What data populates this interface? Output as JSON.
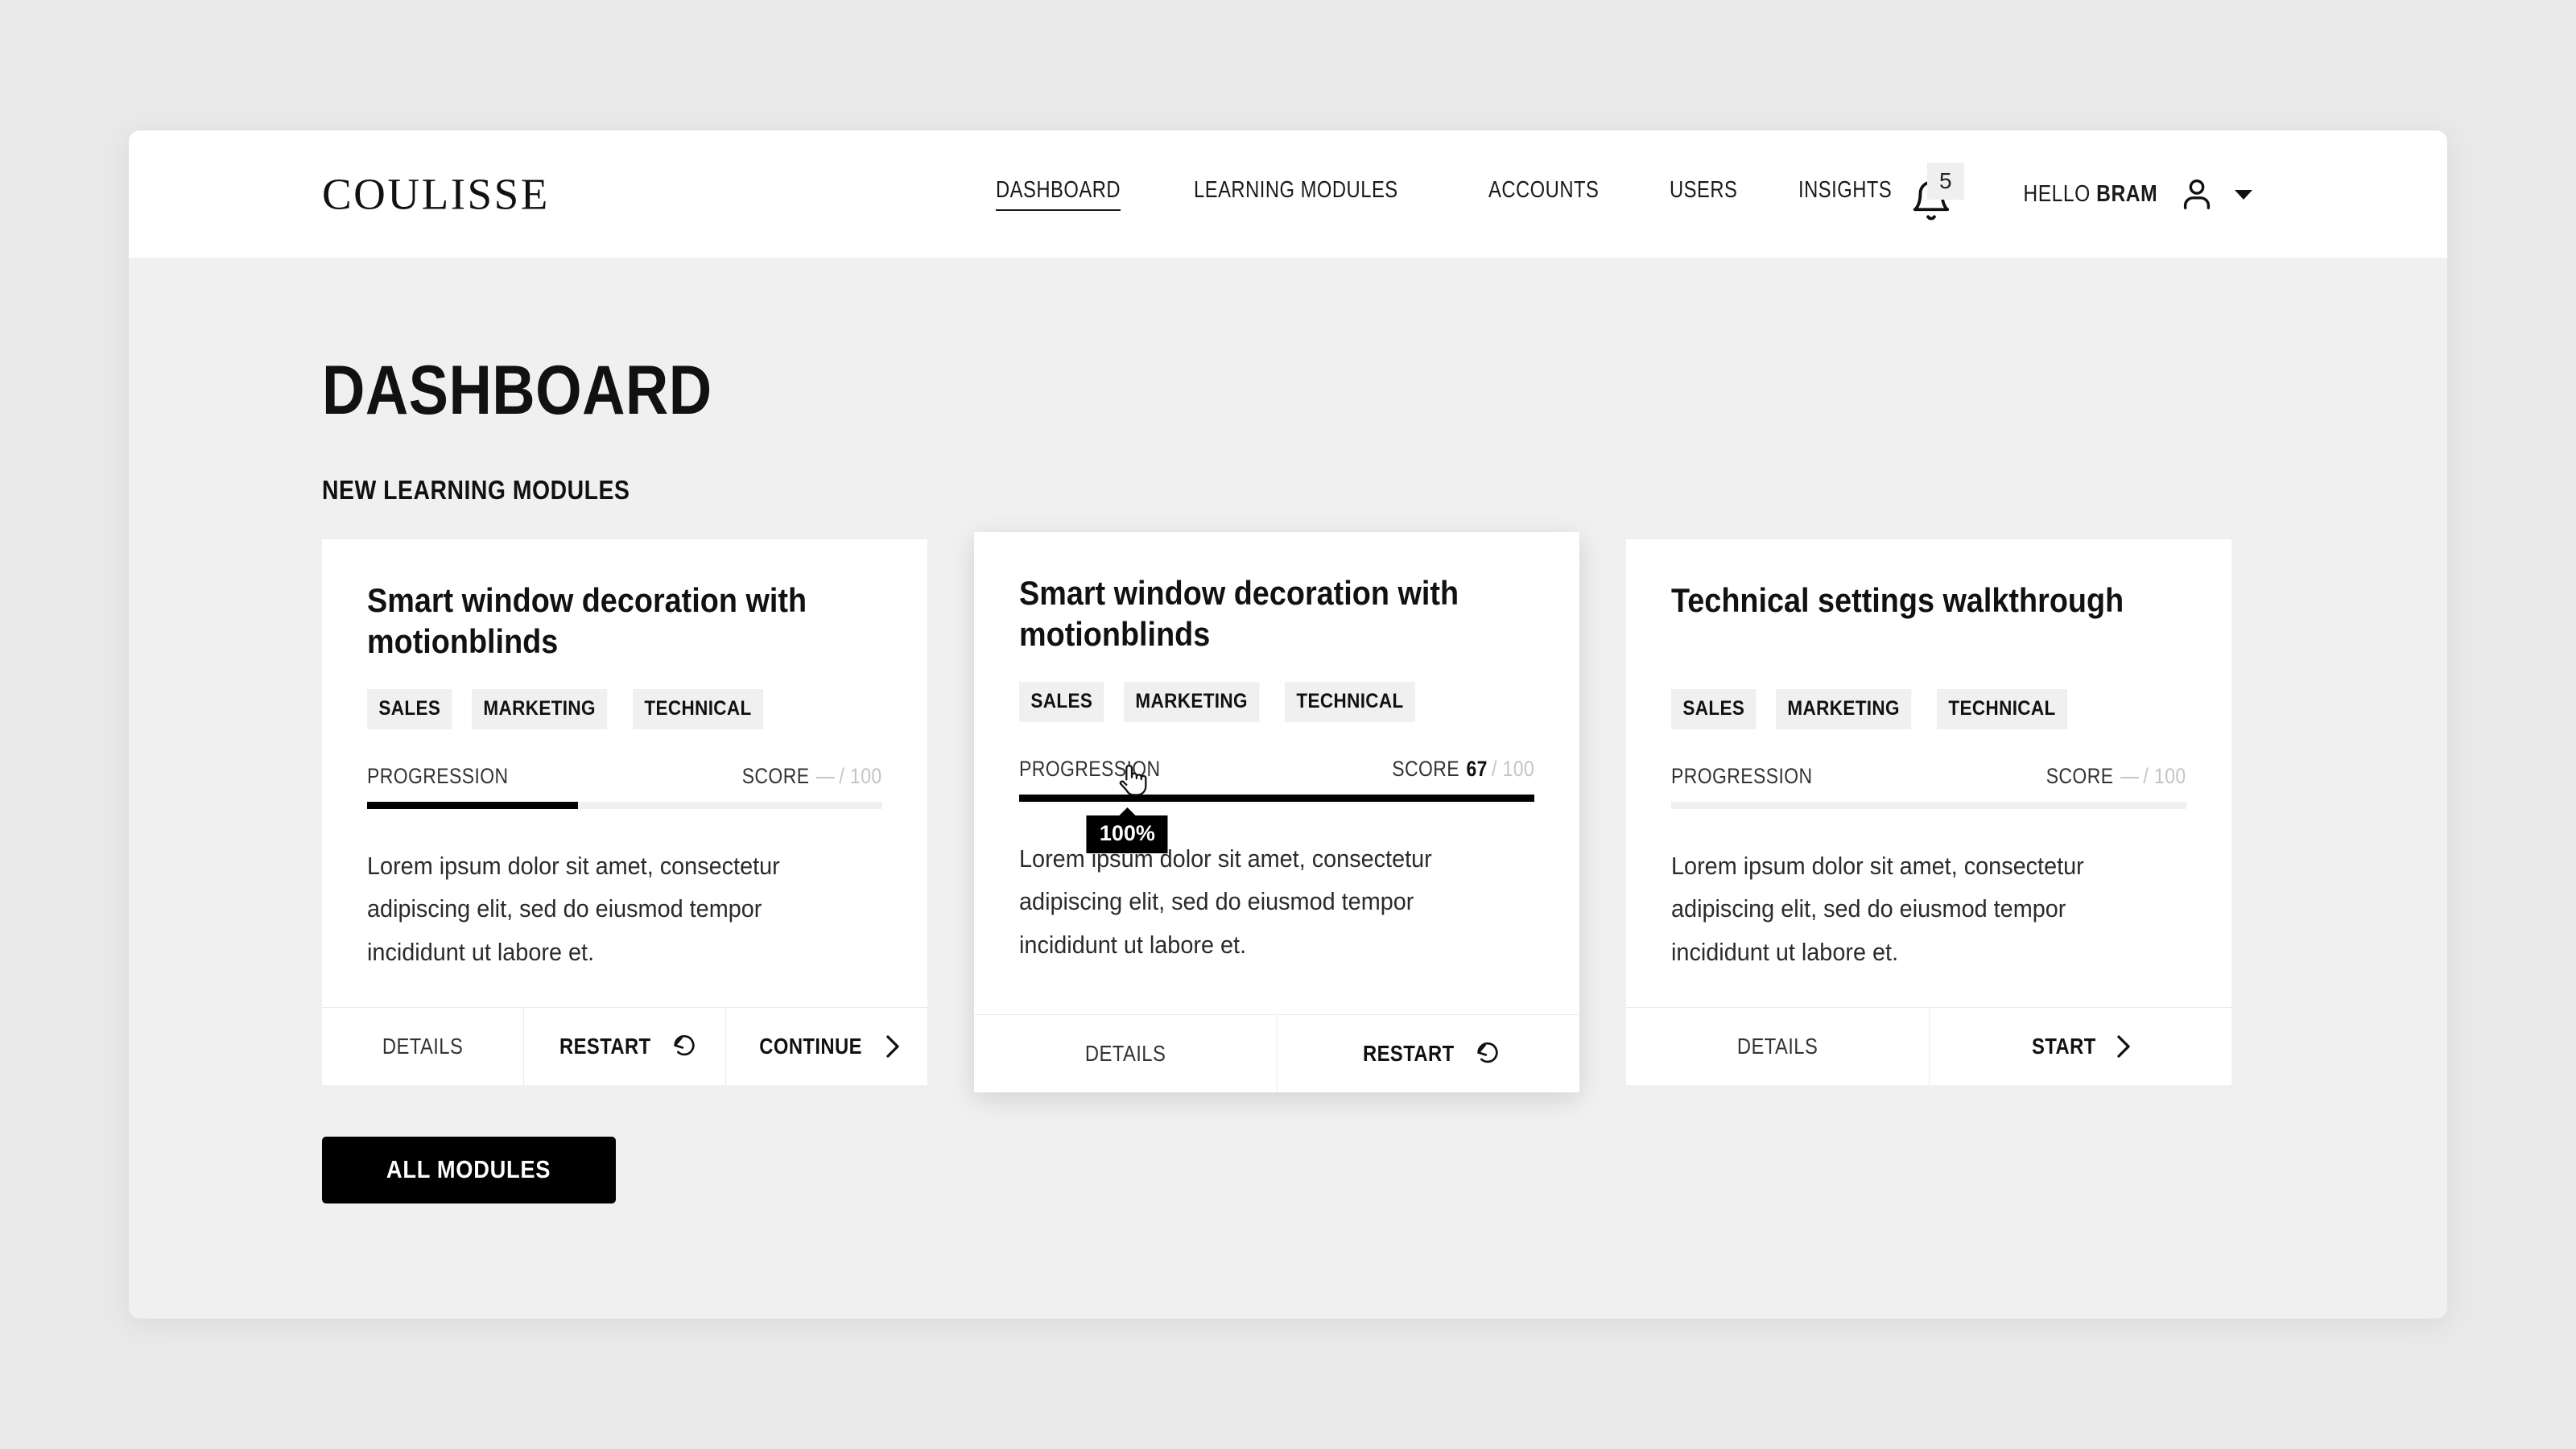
{
  "brand": {
    "logo": "COULISSE"
  },
  "nav": {
    "items": [
      {
        "label": "DASHBOARD",
        "active": true
      },
      {
        "label": "LEARNING MODULES",
        "active": false
      },
      {
        "label": "ACCOUNTS",
        "active": false
      },
      {
        "label": "USERS",
        "active": false
      },
      {
        "label": "INSIGHTS",
        "active": false
      }
    ]
  },
  "header_right": {
    "notification_icon": "bell-icon",
    "notification_count": "5",
    "greeting_prefix": "HELLO ",
    "user_name": "BRAM",
    "avatar_icon": "person-icon",
    "dropdown_icon": "caret-down-icon"
  },
  "page": {
    "title": "DASHBOARD",
    "section_title": "NEW LEARNING MODULES",
    "all_modules_label": "ALL MODULES"
  },
  "labels": {
    "progression": "PROGRESSION",
    "score": "SCORE",
    "score_max": "/ 100",
    "details": "DETAILS",
    "restart": "RESTART",
    "continue": "CONTINUE",
    "start": "START",
    "restart_icon": "restart-arrow-icon",
    "chevron_icon": "chevron-right-icon"
  },
  "colors": {
    "page_background": "#e9e9e9",
    "window_background": "#f0f0f0",
    "card_background": "#ffffff",
    "accent": "#000000",
    "tag_background": "#f0f0f0",
    "muted_text": "#c4c4c4",
    "progress_track": "#f0f0f0"
  },
  "cards": [
    {
      "title": "Smart window decoration with motionblinds",
      "tags": [
        "SALES",
        "MARKETING",
        "TECHNICAL"
      ],
      "progress_percent": 41,
      "score_value": "—",
      "score_is_dash": true,
      "description": "Lorem ipsum dolor sit amet, consectetur adipiscing elit, sed do eiusmod tempor incididunt ut labore et.",
      "raised": false,
      "tooltip": null,
      "actions": [
        {
          "label": "DETAILS",
          "style": "light",
          "icon": null
        },
        {
          "label": "RESTART",
          "style": "bold",
          "icon": "restart-arrow-icon"
        },
        {
          "label": "CONTINUE",
          "style": "bold",
          "icon": "chevron-right-icon"
        }
      ]
    },
    {
      "title": "Smart window decoration with motionblinds",
      "tags": [
        "SALES",
        "MARKETING",
        "TECHNICAL"
      ],
      "progress_percent": 100,
      "score_value": "67",
      "score_is_dash": false,
      "description": "Lorem ipsum dolor sit amet, consectetur adipiscing elit, sed do eiusmod tempor incididunt ut labore et.",
      "raised": true,
      "tooltip": "100%",
      "actions": [
        {
          "label": "DETAILS",
          "style": "light",
          "icon": null
        },
        {
          "label": "RESTART",
          "style": "bold",
          "icon": "restart-arrow-icon"
        }
      ]
    },
    {
      "title": "Technical settings walkthrough",
      "tags": [
        "SALES",
        "MARKETING",
        "TECHNICAL"
      ],
      "progress_percent": 0,
      "score_value": "—",
      "score_is_dash": true,
      "description": "Lorem ipsum dolor sit amet, consectetur adipiscing elit, sed do eiusmod tempor incididunt ut labore et.",
      "raised": false,
      "tooltip": null,
      "actions": [
        {
          "label": "DETAILS",
          "style": "light",
          "icon": null
        },
        {
          "label": "START",
          "style": "bold",
          "icon": "chevron-right-icon"
        }
      ]
    }
  ]
}
